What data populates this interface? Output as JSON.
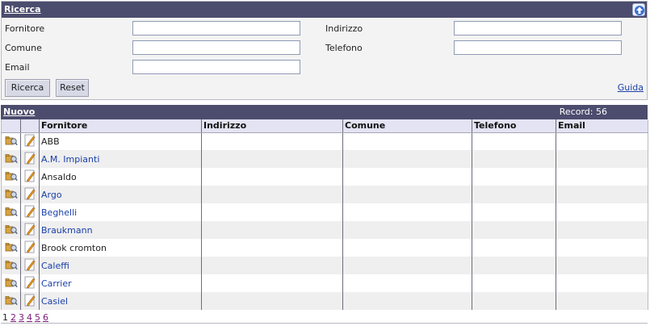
{
  "search": {
    "title": "Ricerca",
    "fields": {
      "fornitore": {
        "label": "Fornitore",
        "value": ""
      },
      "comune": {
        "label": "Comune",
        "value": ""
      },
      "email": {
        "label": "Email",
        "value": ""
      },
      "indirizzo": {
        "label": "Indirizzo",
        "value": ""
      },
      "telefono": {
        "label": "Telefono",
        "value": ""
      }
    },
    "search_button": "Ricerca",
    "reset_button": "Reset",
    "help_link": "Guida"
  },
  "results": {
    "new_link": "Nuovo",
    "record_count": "Record: 56",
    "columns": [
      "Fornitore",
      "Indirizzo",
      "Comune",
      "Telefono",
      "Email"
    ],
    "rows": [
      {
        "fornitore": "ABB",
        "indirizzo": "",
        "comune": "",
        "telefono": "",
        "email": "",
        "link": false
      },
      {
        "fornitore": "A.M. Impianti",
        "indirizzo": "",
        "comune": "",
        "telefono": "",
        "email": "",
        "link": true
      },
      {
        "fornitore": "Ansaldo",
        "indirizzo": "",
        "comune": "",
        "telefono": "",
        "email": "",
        "link": false
      },
      {
        "fornitore": "Argo",
        "indirizzo": "",
        "comune": "",
        "telefono": "",
        "email": "",
        "link": true
      },
      {
        "fornitore": "Beghelli",
        "indirizzo": "",
        "comune": "",
        "telefono": "",
        "email": "",
        "link": true
      },
      {
        "fornitore": "Braukmann",
        "indirizzo": "",
        "comune": "",
        "telefono": "",
        "email": "",
        "link": true
      },
      {
        "fornitore": "Brook cromton",
        "indirizzo": "",
        "comune": "",
        "telefono": "",
        "email": "",
        "link": false
      },
      {
        "fornitore": "Caleffi",
        "indirizzo": "",
        "comune": "",
        "telefono": "",
        "email": "",
        "link": true
      },
      {
        "fornitore": "Carrier",
        "indirizzo": "",
        "comune": "",
        "telefono": "",
        "email": "",
        "link": true
      },
      {
        "fornitore": "Casiel",
        "indirizzo": "",
        "comune": "",
        "telefono": "",
        "email": "",
        "link": true
      }
    ],
    "row_icons": [
      "view-details-icon",
      "edit-pencil-icon"
    ]
  },
  "pager": {
    "current": "1",
    "pages": [
      "2",
      "3",
      "4",
      "5",
      "6"
    ]
  }
}
